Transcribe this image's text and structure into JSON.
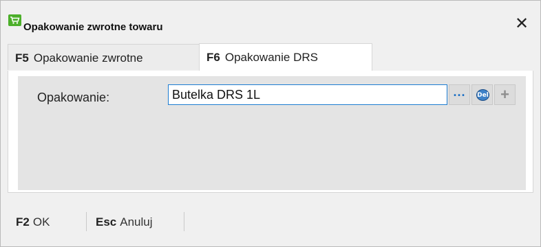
{
  "window": {
    "title": "Opakowanie zwrotne towaru",
    "close_glyph": "✕",
    "icon": "shopping-cart-icon"
  },
  "tabs": [
    {
      "key": "F5",
      "label": "Opakowanie zwrotne",
      "active": false
    },
    {
      "key": "F6",
      "label": "Opakowanie DRS",
      "active": true
    }
  ],
  "form": {
    "packaging_label": "Opakowanie:",
    "packaging_value": "Butelka DRS 1L",
    "browse_label": "...",
    "delete_label": "Del",
    "add_label": "+"
  },
  "footer": {
    "ok_key": "F2",
    "ok_label": "OK",
    "cancel_key": "Esc",
    "cancel_label": "Anuluj"
  },
  "colors": {
    "accent": "#1a7bd1",
    "icon_green": "#4caf2a",
    "window_bg": "#f0f0f0",
    "panel_bg": "#e4e4e4"
  }
}
